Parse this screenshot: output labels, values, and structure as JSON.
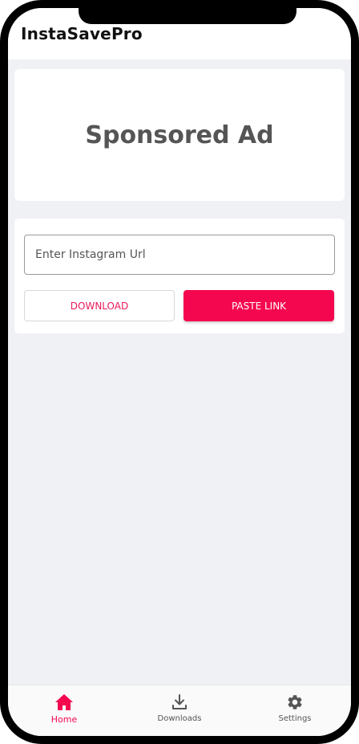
{
  "app": {
    "title": "InstaSavePro"
  },
  "ad": {
    "text": "Sponsored Ad"
  },
  "form": {
    "url_placeholder": "Enter Instagram Url",
    "url_value": "",
    "download_label": "DOWNLOAD",
    "paste_label": "PASTE LINK"
  },
  "nav": {
    "items": [
      {
        "label": "Home",
        "icon": "home-icon",
        "active": true
      },
      {
        "label": "Downloads",
        "icon": "download-icon",
        "active": false
      },
      {
        "label": "Settings",
        "icon": "gear-icon",
        "active": false
      }
    ]
  },
  "colors": {
    "accent": "#f5074f",
    "background": "#f0f1f5",
    "card": "#ffffff"
  }
}
